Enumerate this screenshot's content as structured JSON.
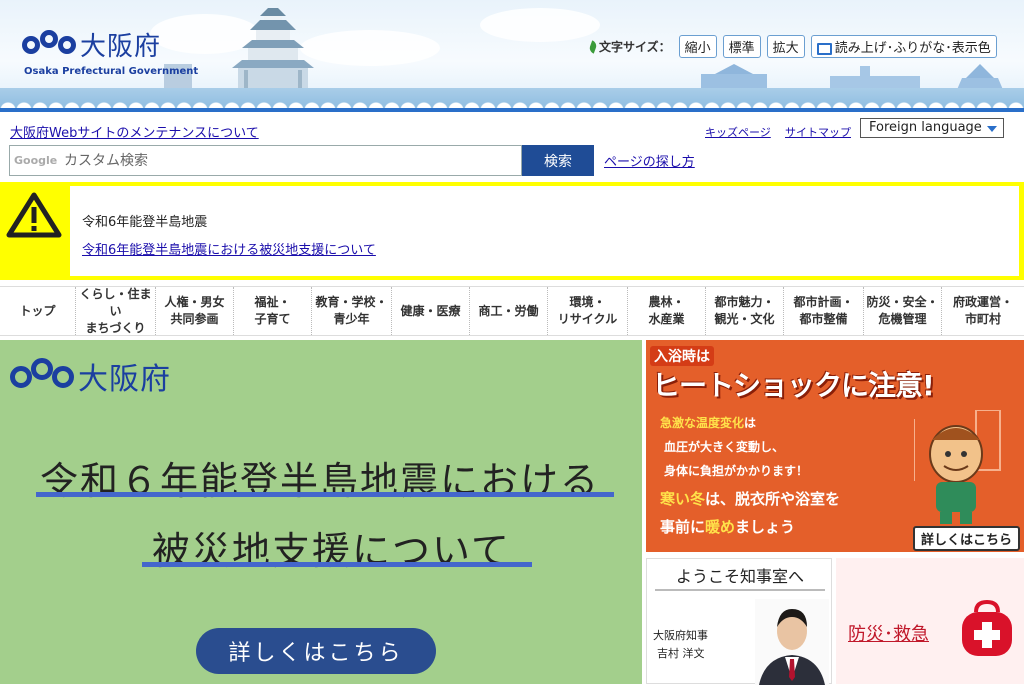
{
  "header": {
    "logo_name": "大阪府",
    "logo_en": "Osaka Prefectural Government",
    "font_size_label": "文字サイズ：",
    "font_buttons": [
      "縮小",
      "標準",
      "拡大"
    ],
    "reader_button": "読み上げ･ふりがな･表示色"
  },
  "utility": {
    "maintenance_link": "大阪府Webサイトのメンテナンスについて",
    "kids_link": "キッズページ",
    "sitemap_link": "サイトマップ",
    "foreign_language": "Foreign language"
  },
  "search": {
    "brand": "Google",
    "placeholder": "カスタム検索",
    "button": "検索",
    "howto_link": "ページの探し方"
  },
  "alert": {
    "title": "令和6年能登半島地震",
    "link": "令和6年能登半島地震における被災地支援について"
  },
  "nav": {
    "items": [
      {
        "l1": "トップ",
        "l2": ""
      },
      {
        "l1": "くらし・住まい",
        "l2": "まちづくり"
      },
      {
        "l1": "人権・男女",
        "l2": "共同参画"
      },
      {
        "l1": "福祉・",
        "l2": "子育て"
      },
      {
        "l1": "教育・学校・",
        "l2": "青少年"
      },
      {
        "l1": "健康・医療",
        "l2": ""
      },
      {
        "l1": "商工・労働",
        "l2": ""
      },
      {
        "l1": "環境・",
        "l2": "リサイクル"
      },
      {
        "l1": "農林・",
        "l2": "水産業"
      },
      {
        "l1": "都市魅力・",
        "l2": "観光・文化"
      },
      {
        "l1": "都市計画・",
        "l2": "都市整備"
      },
      {
        "l1": "防災・安全・",
        "l2": "危機管理"
      },
      {
        "l1": "府政運営・",
        "l2": "市町村"
      }
    ]
  },
  "main_banner": {
    "logo_name": "大阪府",
    "line1": "令和６年能登半島地震における",
    "line2": "被災地支援について",
    "button": "詳しくはこちら"
  },
  "heat_banner": {
    "top": "入浴時は",
    "headline": "ヒートショックに注意!",
    "t1a": "急激な温度変化",
    "t1b": "は",
    "t2": "血圧が大きく変動し、",
    "t3": "身体に負担がかかります！",
    "t4a": "寒い冬",
    "t4b": "は、脱衣所や浴室を",
    "t5a": "事前に",
    "t5b": "暖め",
    "t5c": "ましょう",
    "more": "詳しくはこちら"
  },
  "governor": {
    "title": "ようこそ知事室へ",
    "role": "大阪府知事",
    "name": "吉村 洋文"
  },
  "disaster": {
    "label": "防災･救急"
  }
}
